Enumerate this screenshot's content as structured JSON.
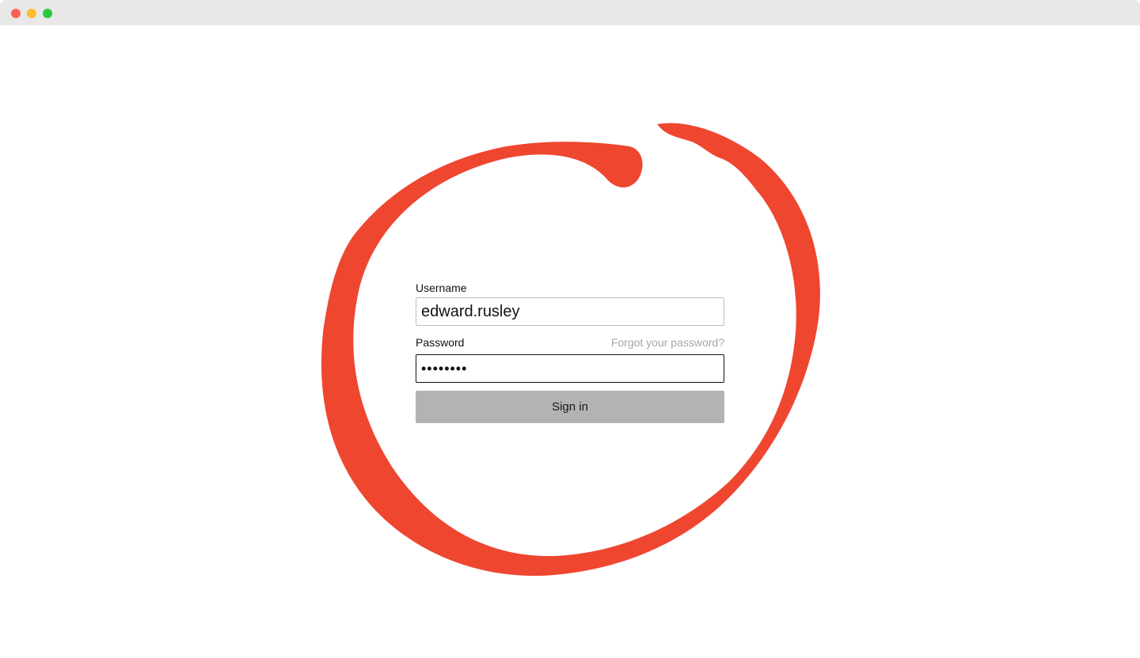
{
  "window": {
    "controls": [
      {
        "name": "close",
        "color": "#ff5f57"
      },
      {
        "name": "minimize",
        "color": "#febc2e"
      },
      {
        "name": "zoom",
        "color": "#28c840"
      }
    ]
  },
  "annotation": {
    "shape": "hand-drawn-circle",
    "color": "#ef4630"
  },
  "form": {
    "username_label": "Username",
    "username_value": "edward.rusley",
    "password_label": "Password",
    "password_value": "••••••••",
    "forgot_link": "Forgot your password?",
    "signin_label": "Sign in",
    "signin_color": "#b3b3b3"
  }
}
